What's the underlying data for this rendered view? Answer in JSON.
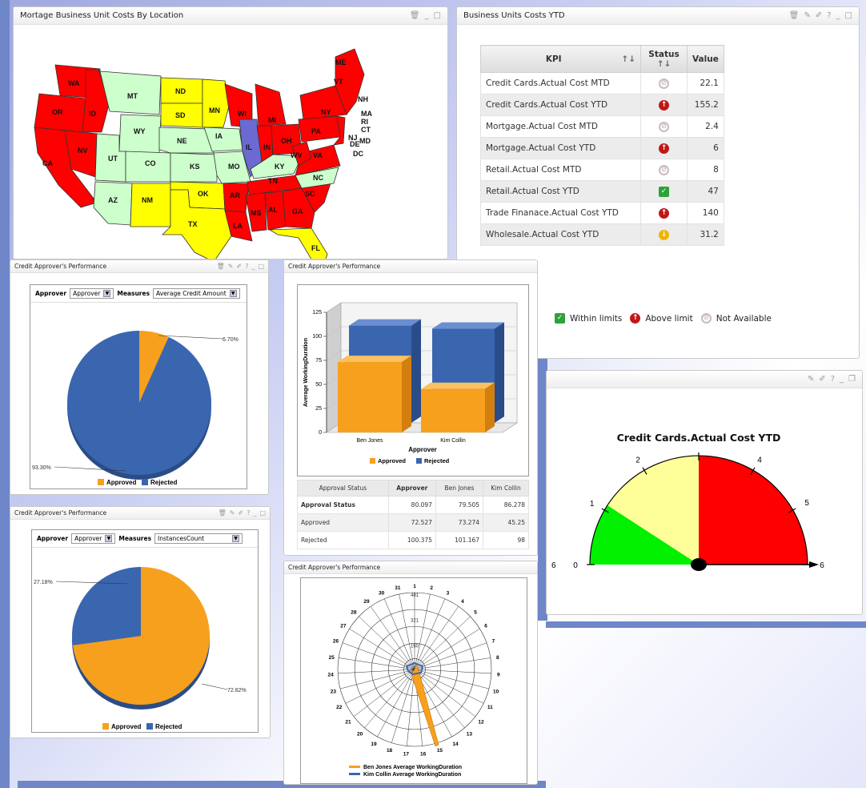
{
  "map_panel": {
    "title": "Mortage Business Unit Costs By Location",
    "states": [
      "WA",
      "OR",
      "ID",
      "MT",
      "ND",
      "MN",
      "WI",
      "MI",
      "NY",
      "VT",
      "ME",
      "NH",
      "MA",
      "RI",
      "CT",
      "NJ",
      "DE",
      "MD",
      "DC",
      "PA",
      "OH",
      "IN",
      "IL",
      "IA",
      "SD",
      "NE",
      "WY",
      "NV",
      "CA",
      "UT",
      "CO",
      "KS",
      "MO",
      "KY",
      "WV",
      "VA",
      "NC",
      "TN",
      "AR",
      "OK",
      "AZ",
      "NM",
      "TX",
      "LA",
      "MS",
      "AL",
      "GA",
      "SC",
      "FL"
    ]
  },
  "kpi_panel": {
    "title": "Business Units Costs YTD",
    "columns": [
      "KPI",
      "Status",
      "Value"
    ],
    "rows": [
      {
        "kpi": "Credit Cards.Actual Cost MTD",
        "status": "na",
        "value": "22.1"
      },
      {
        "kpi": "Credit Cards.Actual Cost YTD",
        "status": "up",
        "value": "155.2"
      },
      {
        "kpi": "Mortgage.Actual Cost MTD",
        "status": "na",
        "value": "2.4"
      },
      {
        "kpi": "Mortgage.Actual Cost YTD",
        "status": "up",
        "value": "6"
      },
      {
        "kpi": "Retail.Actual Cost MTD",
        "status": "na",
        "value": "8"
      },
      {
        "kpi": "Retail.Actual Cost YTD",
        "status": "ok",
        "value": "47"
      },
      {
        "kpi": "Trade Finanace.Actual Cost YTD",
        "status": "up",
        "value": "140"
      },
      {
        "kpi": "Wholesale.Actual Cost YTD",
        "status": "warn",
        "value": "31.2"
      }
    ],
    "legend": {
      "ok": "Within limits",
      "up": "Above limit",
      "na": "Not Available"
    }
  },
  "pie1": {
    "title": "Credit Approver's Performance",
    "approver_label": "Approver",
    "approver_value": "Approver",
    "measures_label": "Measures",
    "measures_value": "Average Credit Amount",
    "label_small": "6.70%",
    "label_big": "93.30%",
    "legend": [
      "Approved",
      "Rejected"
    ]
  },
  "pie2": {
    "title": "Credit Approver's Performance",
    "approver_label": "Approver",
    "approver_value": "Approver",
    "measures_label": "Measures",
    "measures_value": "InstancesCount",
    "label_small": "27.18%",
    "label_big": "72.82%",
    "legend": [
      "Approved",
      "Rejected"
    ]
  },
  "bar_panel": {
    "title": "Credit Approver's Performance",
    "table": {
      "headers": [
        "Approval Status",
        "Approver",
        "Ben Jones",
        "Kim Collin"
      ],
      "rows": [
        [
          "Approval Status",
          "80.097",
          "79.505",
          "86.278"
        ],
        [
          "Approved",
          "72.527",
          "73.274",
          "45.25"
        ],
        [
          "Rejected",
          "100.375",
          "101.167",
          "98"
        ]
      ]
    }
  },
  "radar_panel": {
    "title": "Credit Approver's Performance",
    "ring_labels": [
      "481",
      "321",
      "160"
    ],
    "legend": [
      "Ben Jones Average WorkingDuration",
      "Kim Collin Average WorkingDuration"
    ]
  },
  "gauge_panel": {
    "title": "Credit Cards.Actual Cost YTD",
    "ticks": [
      "0",
      "1",
      "2",
      "4",
      "5",
      "6"
    ],
    "left_edge_label": "6"
  },
  "colors": {
    "approved": "#f7a01d",
    "rejected": "#3a66b0",
    "red": "#ff0000",
    "yellow": "#ffff00",
    "green": "#ccffcc",
    "purple": "#6a6ad0"
  },
  "chart_data": [
    {
      "type": "pie",
      "title": "",
      "categories": [
        "Approved",
        "Rejected"
      ],
      "values": [
        6.7,
        93.3
      ]
    },
    {
      "type": "pie",
      "title": "",
      "categories": [
        "Approved",
        "Rejected"
      ],
      "values": [
        72.82,
        27.18
      ]
    },
    {
      "type": "bar",
      "categories": [
        "Ben Jones",
        "Kim Collin"
      ],
      "series": [
        {
          "name": "Approved",
          "values": [
            73.274,
            45.25
          ]
        },
        {
          "name": "Rejected",
          "values": [
            101.167,
            98
          ]
        }
      ],
      "xlabel": "Approver",
      "ylabel": "Average WorkingDuration",
      "ylim": [
        0,
        125
      ],
      "yticks": [
        "0",
        "25",
        "50",
        "75",
        "100",
        "125"
      ]
    }
  ]
}
